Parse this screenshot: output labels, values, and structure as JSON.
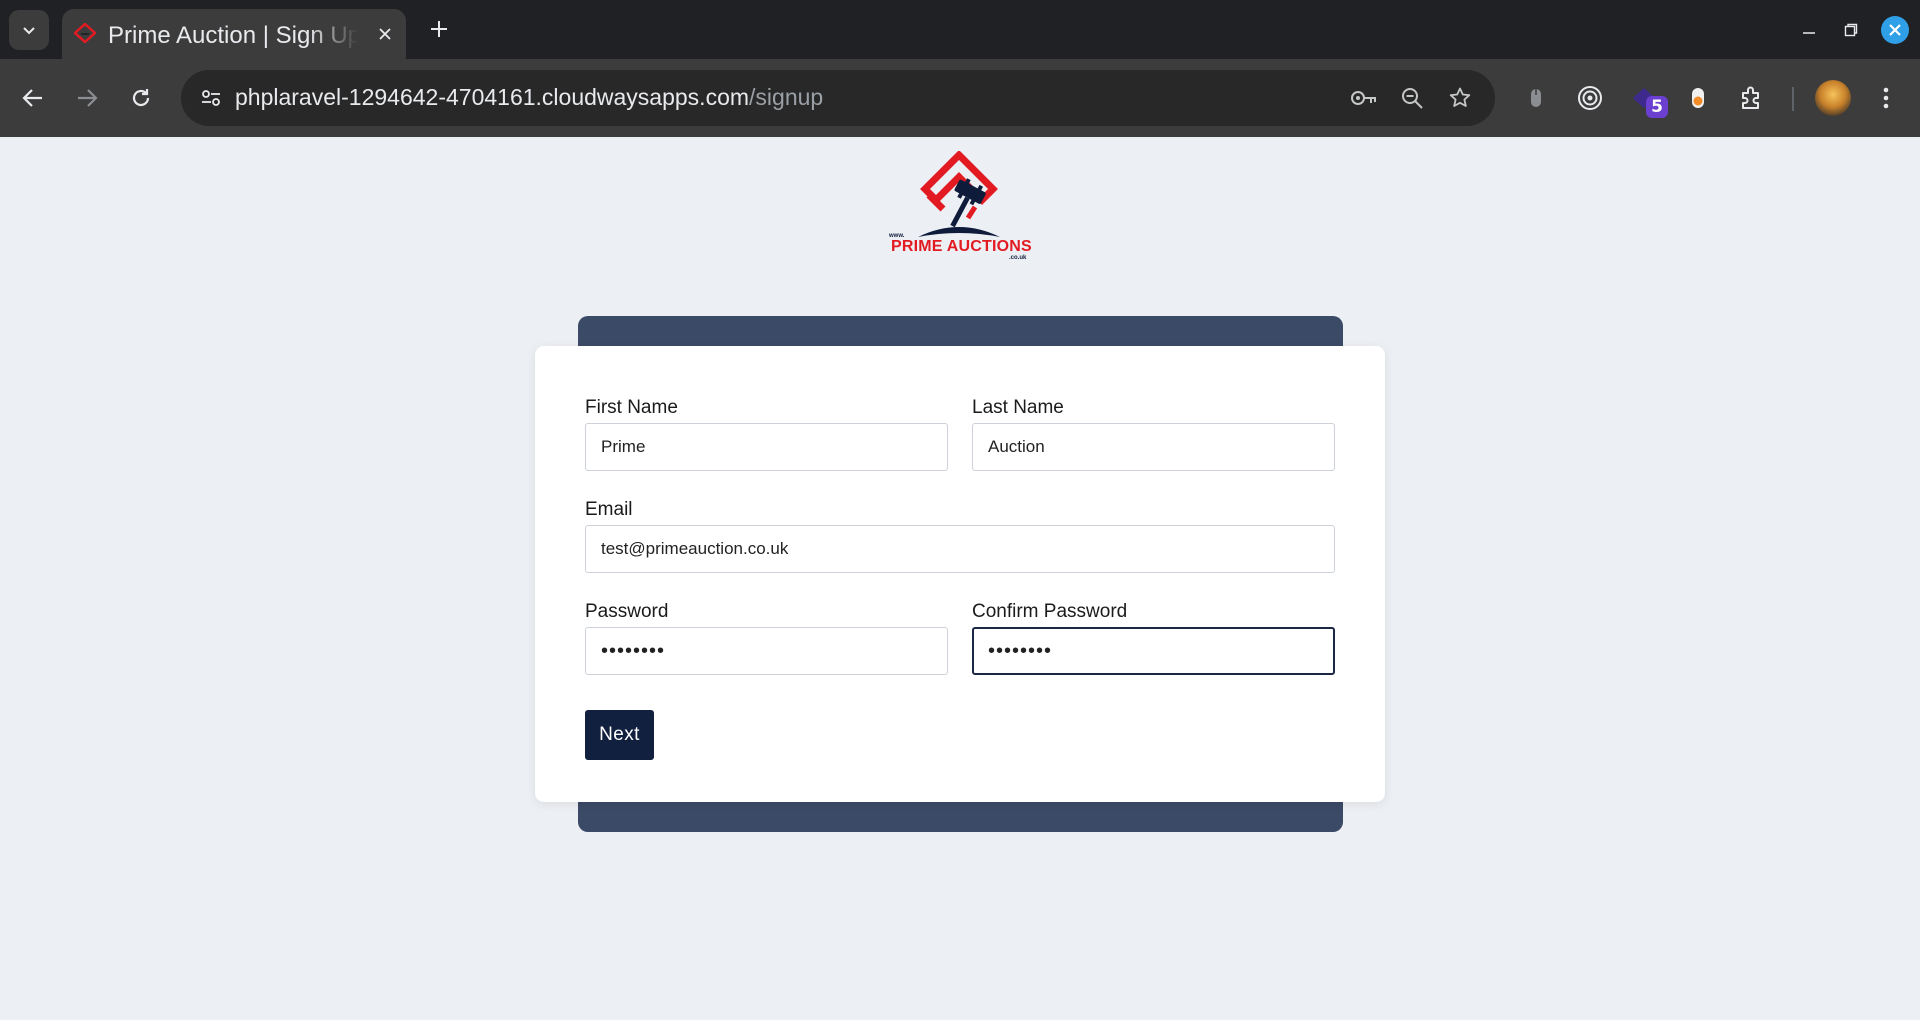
{
  "browser": {
    "tab_title": "Prime Auction | Sign Up",
    "url_host": "phplaravel-1294642-4704161.cloudwaysapps.com",
    "url_path": "/signup",
    "extension_badge": "5"
  },
  "logo": {
    "www": "www.",
    "name": "PRIME AUCTIONS",
    "tld": ".co.uk"
  },
  "form": {
    "first_name": {
      "label": "First Name",
      "value": "Prime"
    },
    "last_name": {
      "label": "Last Name",
      "value": "Auction"
    },
    "email": {
      "label": "Email",
      "value": "test@primeauction.co.uk"
    },
    "password": {
      "label": "Password",
      "value": "••••••••"
    },
    "confirm_password": {
      "label": "Confirm Password",
      "value": "••••••••"
    },
    "next_label": "Next"
  },
  "colors": {
    "primary": "#12203f",
    "back_card": "#3b4a66",
    "brand_red": "#e21b23",
    "page_bg": "#eceff3"
  }
}
